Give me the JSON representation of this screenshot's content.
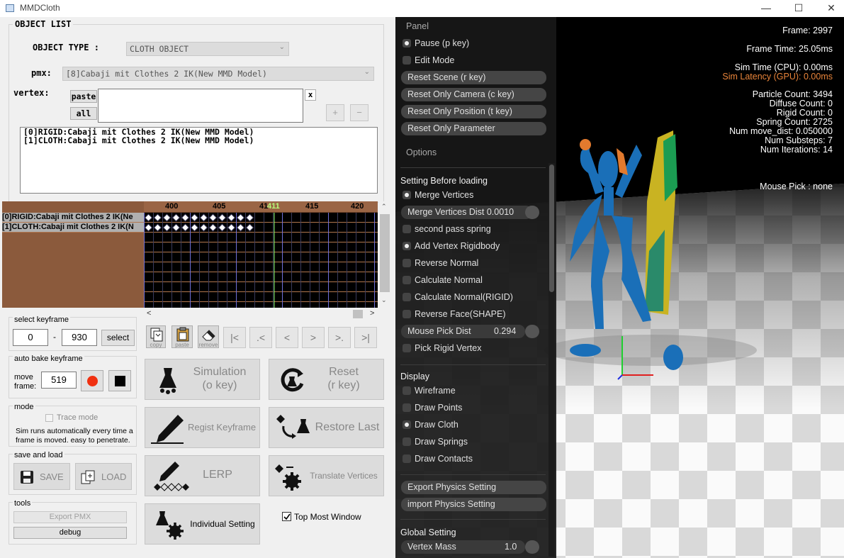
{
  "window": {
    "title": "MMDCloth",
    "minimize": "—",
    "maximize": "☐",
    "close": "✕"
  },
  "object_list": {
    "group_label": "OBJECT LIST",
    "type_label": "OBJECT TYPE :",
    "type_value": "CLOTH OBJECT",
    "pmx_label": "pmx:",
    "pmx_value": "[8]Cabaji mit Clothes 2 IK(New MMD Model)",
    "vertex_label": "vertex:",
    "paste": "paste",
    "all": "all",
    "x": "x",
    "plus": "+",
    "minus": "−",
    "items": [
      "[0]RIGID:Cabaji mit Clothes 2 IK(New MMD Model)",
      "[1]CLOTH:Cabaji mit Clothes 2 IK(New MMD Model)"
    ]
  },
  "timeline": {
    "ticks": [
      "400",
      "405",
      "41",
      "411",
      "415",
      "420"
    ],
    "tracks": [
      "[0]RIGID:Cabaji mit Clothes 2 IK(Ne",
      "[1]CLOTH:Cabaji mit Clothes 2 IK(N"
    ],
    "keyframes_per_track": 12,
    "current_frame": 411
  },
  "select_keyframe": {
    "label": "select keyframe",
    "from": "0",
    "dash": "-",
    "to": "930",
    "select": "select"
  },
  "icon_tools": {
    "copy": "copy",
    "paste": "paste",
    "remove": "remove"
  },
  "nav": [
    "|<",
    ".<",
    "<",
    ">",
    ">.",
    ">|"
  ],
  "auto_bake": {
    "label": "auto bake keyframe",
    "move_label": "move",
    "frame_label": "frame:",
    "value": "519"
  },
  "mode": {
    "label": "mode",
    "trace": "Trace mode",
    "desc1": "Sim runs automatically every time a",
    "desc2": "frame is moved. easy to penetrate."
  },
  "save_load": {
    "label": "save and load",
    "save": "SAVE",
    "load": "LOAD"
  },
  "tools": {
    "label": "tools",
    "export": "Export PMX",
    "debug": "debug"
  },
  "big": {
    "simulation": "Simulation",
    "sim_key": "(o key)",
    "reset": "Reset",
    "reset_key": "(r key)",
    "regist": "Regist Keyframe",
    "restore": "Restore Last",
    "lerp": "LERP",
    "translate": "Translate Vertices",
    "individual": "Individual Setting",
    "top_most": "Top Most Window"
  },
  "panel": {
    "title": "Panel",
    "pause": "Pause (p key)",
    "edit": "Edit Mode",
    "reset_scene": "Reset Scene (r key)",
    "reset_camera": "Reset Only Camera (c key)",
    "reset_position": "Reset Only Position (t key)",
    "reset_param": "Reset Only Parameter",
    "options": "Options",
    "setting_before": "Setting Before loading",
    "merge": "Merge Vertices",
    "merge_dist": "Merge Vertices Dist",
    "merge_dist_val": "0.0010",
    "second_pass": "second pass spring",
    "add_vertex": "Add Vertex Rigidbody",
    "reverse_normal": "Reverse Normal",
    "calc_normal": "Calculate Normal",
    "calc_normal_rigid": "Calculate Normal(RIGID)",
    "reverse_face": "Reverse Face(SHAPE)",
    "mouse_pick_dist": "Mouse Pick Dist",
    "mouse_pick_dist_val": "0.294",
    "pick_rigid": "Pick Rigid Vertex",
    "display": "Display",
    "wireframe": "Wireframe",
    "draw_points": "Draw Points",
    "draw_cloth": "Draw Cloth",
    "draw_springs": "Draw Springs",
    "draw_contacts": "Draw Contacts",
    "export_physics": "Export Physics Setting",
    "import_physics": "import Physics Setting",
    "global": "Global Setting",
    "vertex_mass": "Vertex Mass",
    "vertex_mass_val": "1.0"
  },
  "stats": {
    "frame": "Frame: 2997",
    "frame_time": "Frame Time: 25.05ms",
    "sim_time": "Sim Time (CPU): 0.00ms",
    "sim_latency": "Sim Latency (GPU): 0.00ms",
    "particle": "Particle Count: 3494",
    "diffuse": "Diffuse Count: 0",
    "rigid": "Rigid Count: 0",
    "spring": "Spring Count: 2725",
    "move_dist": "Num move_dist: 0.050000",
    "substeps": "Num Substeps: 7",
    "iterations": "Num Iterations: 14",
    "mouse_pick": "Mouse Pick : none"
  },
  "colors": {
    "accent_orange": "#e8843a",
    "model_blue": "#1c6fbd",
    "panel_bg": "#181818"
  }
}
